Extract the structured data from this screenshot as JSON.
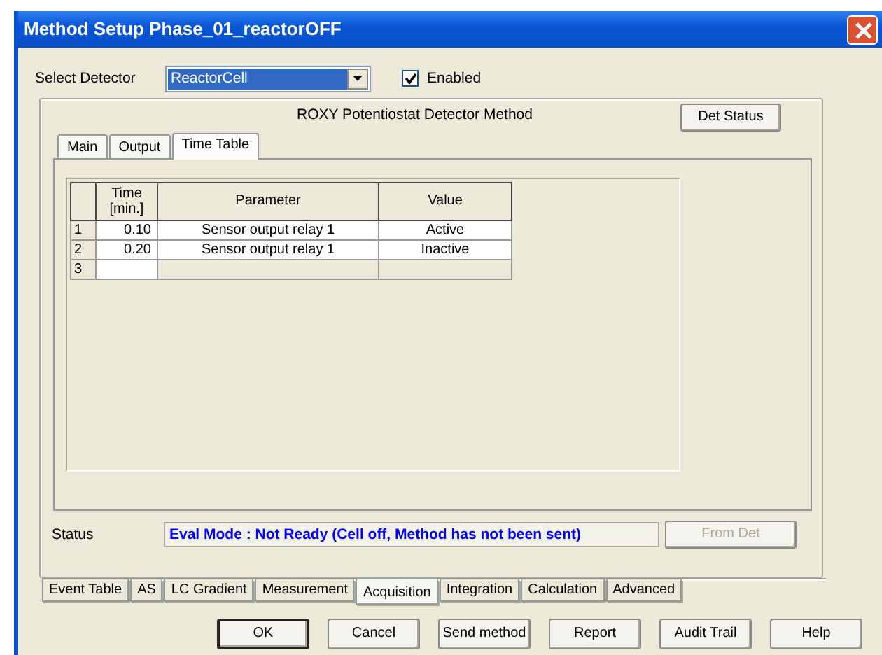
{
  "window": {
    "title": "Method Setup Phase_01_reactorOFF"
  },
  "detector": {
    "label": "Select Detector",
    "value": "ReactorCell",
    "enabled_label": "Enabled",
    "enabled": true
  },
  "method_title": "ROXY Potentiostat Detector Method",
  "det_status_button": {
    "label": "Det Status",
    "disabled": false
  },
  "tabs": [
    {
      "label": "Main",
      "selected": false
    },
    {
      "label": "Output",
      "selected": false
    },
    {
      "label": "Time Table",
      "selected": true
    }
  ],
  "table": {
    "columns": [
      "Time [min.]",
      "Parameter",
      "Value"
    ],
    "rows": [
      {
        "number": "1",
        "time": "0.10",
        "parameter": "Sensor output relay 1",
        "value": "Active"
      },
      {
        "number": "2",
        "time": "0.20",
        "parameter": "Sensor output relay 1",
        "value": "Inactive"
      },
      {
        "number": "3"
      }
    ]
  },
  "status": {
    "label": "Status",
    "text": "Eval Mode : Not Ready (Cell off, Method has not been sent)"
  },
  "from_det_button": {
    "label": "From Det",
    "disabled": true
  },
  "bottom_tabs": [
    {
      "label": "Event Table",
      "selected": false
    },
    {
      "label": "AS",
      "selected": false
    },
    {
      "label": "LC Gradient",
      "selected": false
    },
    {
      "label": "Measurement",
      "selected": false
    },
    {
      "label": "Acquisition",
      "selected": true
    },
    {
      "label": "Integration",
      "selected": false
    },
    {
      "label": "Calculation",
      "selected": false
    },
    {
      "label": "Advanced",
      "selected": false
    }
  ],
  "buttons": [
    {
      "label": "OK",
      "default": true
    },
    {
      "label": "Cancel",
      "default": false
    },
    {
      "label": "Send method",
      "default": false
    },
    {
      "label": "Report",
      "default": false
    },
    {
      "label": "Audit Trail",
      "default": false
    },
    {
      "label": "Help",
      "default": false
    }
  ]
}
